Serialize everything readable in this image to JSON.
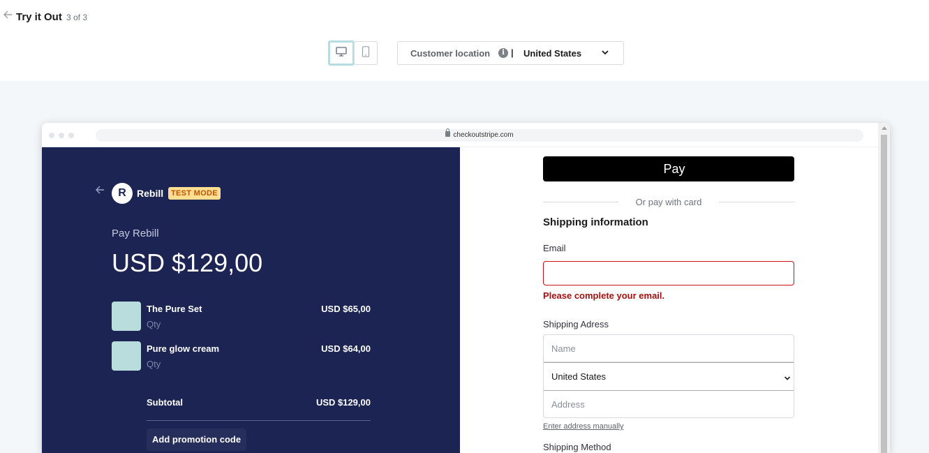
{
  "header": {
    "title": "Try it Out",
    "step": "3 of 3",
    "location_label": "Customer location",
    "location_separator": "|",
    "location_value": "United States"
  },
  "browser": {
    "url": "checkoutstripe.com"
  },
  "order": {
    "merchant_initial": "R",
    "merchant_name": "Rebill",
    "mode_badge": "TEST MODE",
    "pay_label": "Pay Rebill",
    "total": "USD $129,00",
    "items": [
      {
        "name": "The Pure Set",
        "qty": "Qty",
        "price": "USD $65,00"
      },
      {
        "name": "Pure glow cream",
        "qty": "Qty",
        "price": "USD $64,00"
      }
    ],
    "subtotal_label": "Subtotal",
    "subtotal_value": "USD $129,00",
    "promo_label": "Add promotion code"
  },
  "form": {
    "pay_button": "Pay",
    "or_text": "Or pay with card",
    "section_title": "Shipping information",
    "email_label": "Email",
    "email_value": "",
    "email_error": "Please complete your email.",
    "shipping_label": "Shipping Adress",
    "name_placeholder": "Name",
    "country_value": "United States",
    "address_placeholder": "Address",
    "enter_manual": "Enter address manually",
    "shipping_method_label": "Shipping Method"
  },
  "colors": {
    "left_panel_bg": "#1b2452",
    "badge_bg": "#ffde92",
    "badge_text": "#bb5504",
    "error": "#a31010",
    "thumb": "#b9dcdc"
  },
  "icons": [
    "back-arrow-icon",
    "desktop-icon",
    "mobile-icon",
    "info-icon",
    "chevron-down-icon",
    "lock-icon"
  ]
}
